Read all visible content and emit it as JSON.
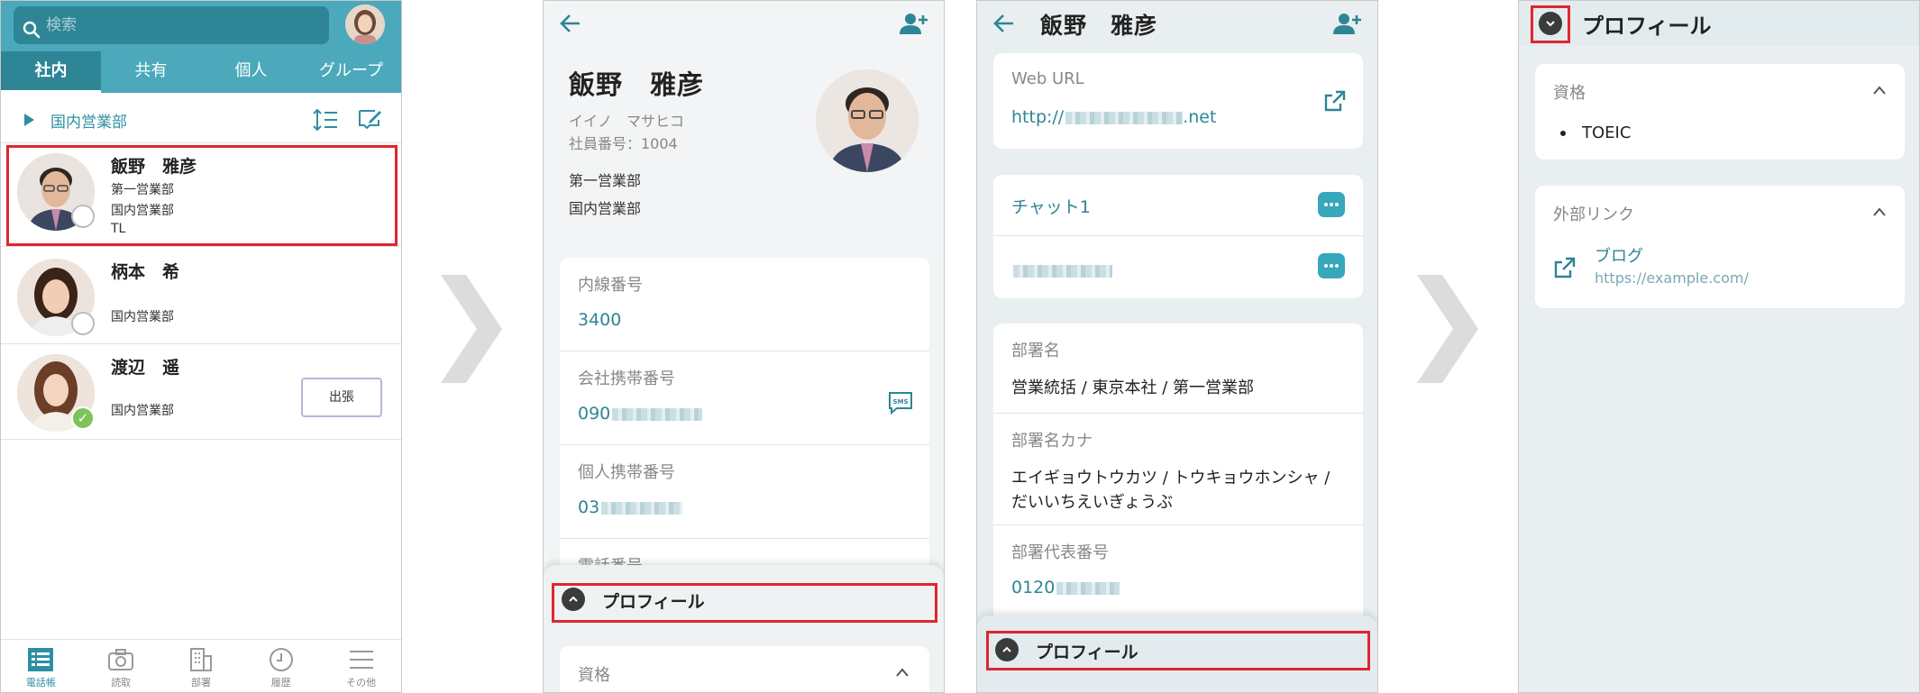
{
  "screen1": {
    "search_placeholder": "検索",
    "tabs": [
      {
        "label": "社内",
        "active": true
      },
      {
        "label": "共有",
        "active": false
      },
      {
        "label": "個人",
        "active": false
      },
      {
        "label": "グループ",
        "active": false
      }
    ],
    "department": "国内営業部",
    "contacts": [
      {
        "name": "飯野　雅彦",
        "lines": [
          "第一営業部",
          "国内営業部",
          "TL"
        ],
        "status": "none",
        "badge": ""
      },
      {
        "name": "柄本　希",
        "lines": [
          "",
          "国内営業部"
        ],
        "status": "none",
        "badge": ""
      },
      {
        "name": "渡辺　遥",
        "lines": [
          "",
          "国内営業部"
        ],
        "status": "available",
        "badge": "出張"
      }
    ],
    "bottom_nav": [
      {
        "label": "電話帳",
        "active": true
      },
      {
        "label": "読取",
        "active": false
      },
      {
        "label": "部署",
        "active": false
      },
      {
        "label": "履歴",
        "active": false
      },
      {
        "label": "その他",
        "active": false
      }
    ]
  },
  "screen2": {
    "name": "飯野　雅彦",
    "kana": "イイノ　マサヒコ",
    "employee_number": "社員番号：1004",
    "dept1": "第一営業部",
    "dept2": "国内営業部",
    "fields": [
      {
        "label": "内線番号",
        "value": "3400"
      },
      {
        "label": "会社携帯番号",
        "value": "090"
      },
      {
        "label": "個人携帯番号",
        "value": "03"
      },
      {
        "label": "電話番号",
        "value": ""
      }
    ],
    "sms_label": "SMS",
    "sheet_title": "プロフィール",
    "section_label": "資格"
  },
  "screen3": {
    "title": "飯野　雅彦",
    "web_url_label": "Web URL",
    "web_url_prefix": "http://",
    "web_url_suffix": ".net",
    "chat1": "チャット1",
    "fields": [
      {
        "label": "部署名",
        "value": "営業統括 / 東京本社 / 第一営業部"
      },
      {
        "label": "部署名カナ",
        "value": "エイギョウトウカツ / トウキョウホンシャ / だいいちえいぎょうぶ"
      },
      {
        "label": "部署代表番号",
        "value": "0120"
      }
    ],
    "sheet_title": "プロフィール"
  },
  "screen4": {
    "title": "プロフィール",
    "qualification_label": "資格",
    "qualification_item": "TOEIC",
    "external_links_label": "外部リンク",
    "link_title": "ブログ",
    "link_url": "https://example.com/"
  },
  "colors": {
    "accent": "#4ba9bb",
    "accent_dark": "#2e8596",
    "highlight": "#e0252f",
    "chat_icon": "#37a7bc"
  }
}
